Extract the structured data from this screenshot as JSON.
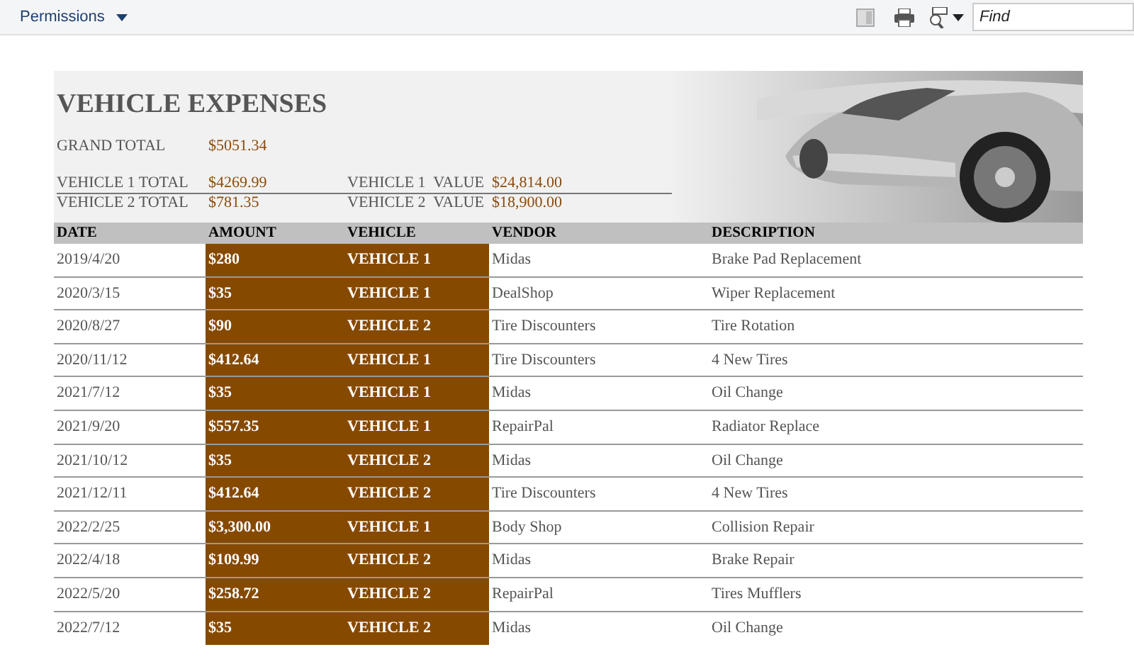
{
  "toolbar": {
    "menu": "Permissions",
    "find": {
      "placeholder": "Find"
    }
  },
  "report": {
    "title": "VEHICLE EXPENSES",
    "grand_total": {
      "label": "GRAND TOTAL",
      "value": "$5051.34"
    },
    "totals": [
      {
        "label": "VEHICLE 1 TOTAL",
        "value": "$4269.99",
        "value_label": "VEHICLE 1  VALUE",
        "worth": "$24,814.00"
      },
      {
        "label": "VEHICLE 2 TOTAL",
        "value": "$781.35",
        "value_label": "VEHICLE 2  VALUE",
        "worth": "$18,900.00"
      }
    ]
  },
  "table": {
    "columns": [
      "DATE",
      "AMOUNT",
      "VEHICLE",
      "VENDOR",
      "DESCRIPTION"
    ],
    "rows": [
      [
        "2019/4/20",
        "$280",
        "VEHICLE 1",
        "Midas",
        "Brake Pad Replacement"
      ],
      [
        "2020/3/15",
        "$35",
        "VEHICLE 1",
        "DealShop",
        "Wiper Replacement"
      ],
      [
        "2020/8/27",
        "$90",
        "VEHICLE 2",
        "Tire Discounters",
        "Tire Rotation"
      ],
      [
        "2020/11/12",
        "$412.64",
        "VEHICLE 1",
        "Tire Discounters",
        "4 New Tires"
      ],
      [
        "2021/7/12",
        "$35",
        "VEHICLE 1",
        "Midas",
        "Oil Change"
      ],
      [
        "2021/9/20",
        "$557.35",
        "VEHICLE 1",
        "RepairPal",
        "Radiator Replace"
      ],
      [
        "2021/10/12",
        "$35",
        "VEHICLE 2",
        "Midas",
        "Oil Change"
      ],
      [
        "2021/12/11",
        "$412.64",
        "VEHICLE 2",
        "Tire Discounters",
        "4 New Tires"
      ],
      [
        "2022/2/25",
        "$3,300.00",
        "VEHICLE 1",
        "Body Shop",
        "Collision Repair"
      ],
      [
        "2022/4/18",
        "$109.99",
        "VEHICLE 2",
        "Midas",
        "Brake Repair"
      ],
      [
        "2022/5/20",
        "$258.72",
        "VEHICLE 2",
        "RepairPal",
        "Tires Mufflers"
      ],
      [
        "2022/7/12",
        "$35",
        "VEHICLE 2",
        "Midas",
        "Oil Change"
      ]
    ]
  }
}
